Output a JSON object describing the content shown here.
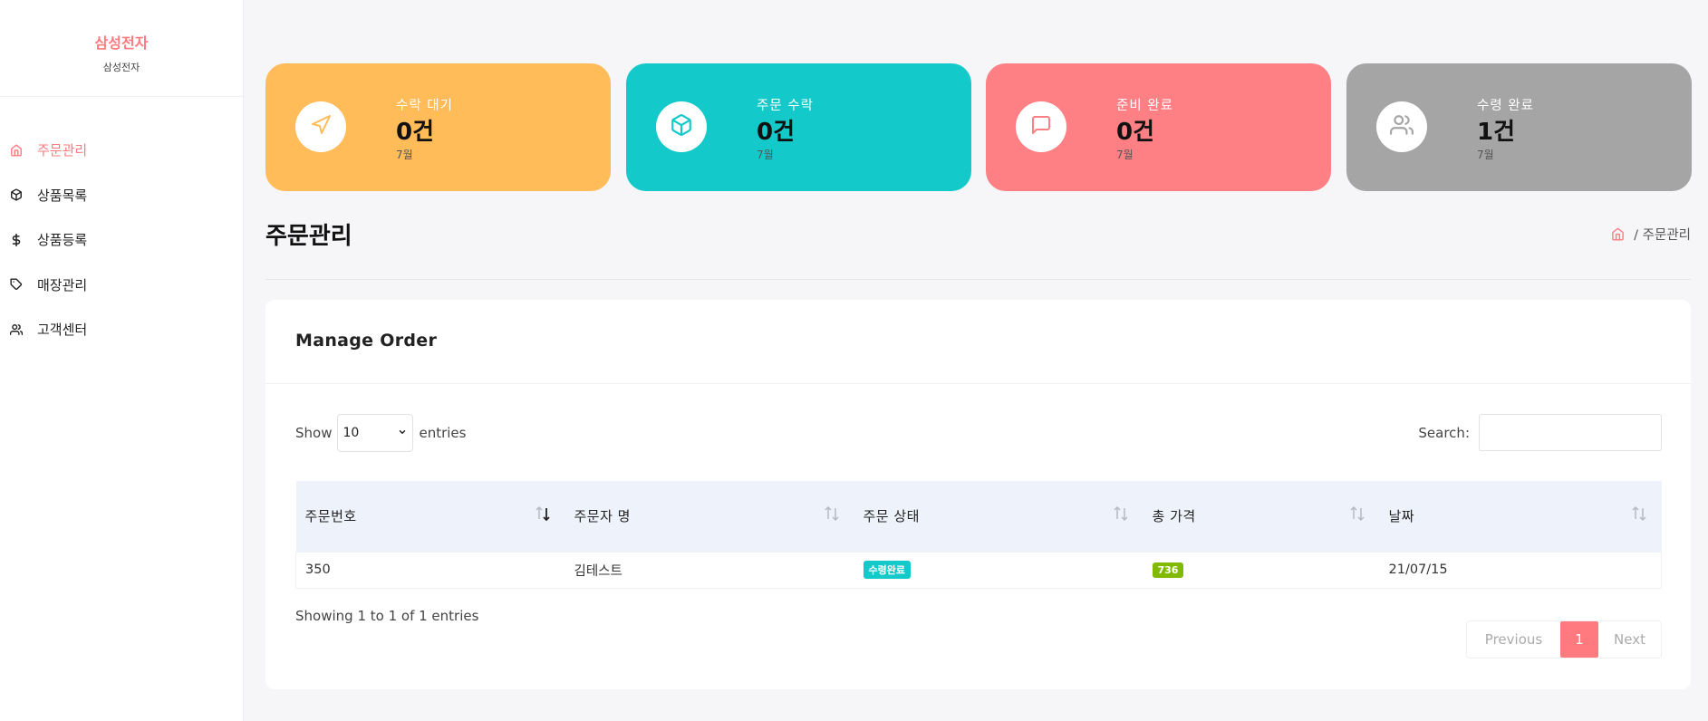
{
  "brand": {
    "title": "삼성전자",
    "subtitle": "삼성전자"
  },
  "sidebar": {
    "items": [
      {
        "label": "주문관리",
        "icon": "home-icon",
        "active": true
      },
      {
        "label": "상품목록",
        "icon": "box-icon",
        "active": false
      },
      {
        "label": "상품등록",
        "icon": "dollar-icon",
        "active": false
      },
      {
        "label": "매장관리",
        "icon": "tag-icon",
        "active": false
      },
      {
        "label": "고객센터",
        "icon": "users-icon",
        "active": false
      }
    ]
  },
  "cards": [
    {
      "label": "수락 대기",
      "value": "0건",
      "sub": "7월",
      "color": "#ffbc58",
      "icon": "send-icon"
    },
    {
      "label": "주문 수락",
      "value": "0건",
      "sub": "7월",
      "color": "#13c9ca",
      "icon": "box-icon"
    },
    {
      "label": "준비 완료",
      "value": "0건",
      "sub": "7월",
      "color": "#ff8084",
      "icon": "message-icon"
    },
    {
      "label": "수령 완료",
      "value": "1건",
      "sub": "7월",
      "color": "#a5a5a5",
      "icon": "users-icon"
    }
  ],
  "page": {
    "title": "주문관리",
    "breadcrumb": "/ 주문관리"
  },
  "panel": {
    "title": "Manage Order",
    "show_label": "Show",
    "page_length": "10",
    "entries_label": "entries",
    "search_label": "Search:",
    "search_value": "",
    "columns": [
      "주문번호",
      "주문자 명",
      "주문 상태",
      "총 가격",
      "날짜"
    ],
    "rows": [
      {
        "order_no": "350",
        "customer": "김테스트",
        "status": "수령완료",
        "status_color": "#13c9ca",
        "total": "736",
        "total_color": "#81ba00",
        "date": "21/07/15"
      }
    ],
    "info": "Showing 1 to 1 of 1 entries",
    "pagination": {
      "previous": "Previous",
      "current": "1",
      "next": "Next"
    }
  }
}
